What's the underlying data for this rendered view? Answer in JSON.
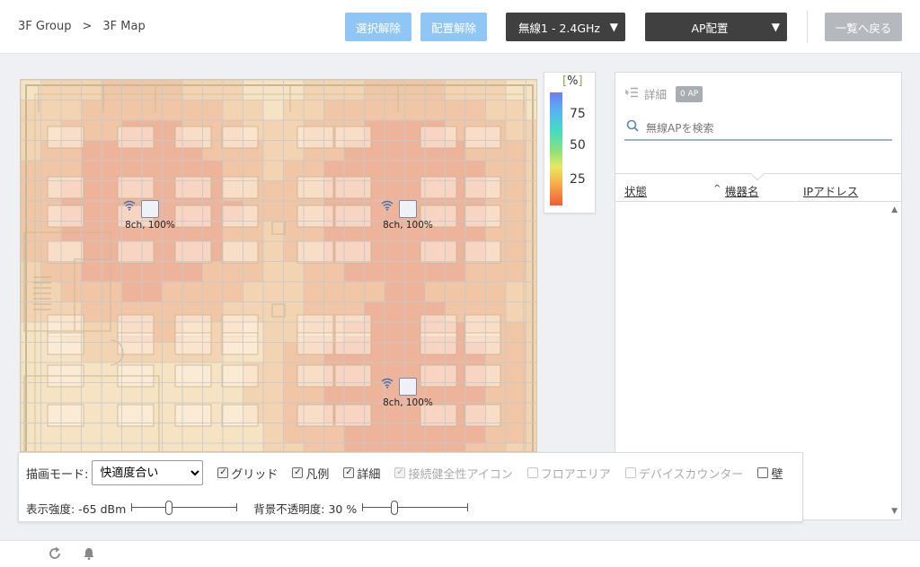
{
  "breadcrumb": {
    "group": "3F Group",
    "separator": ">",
    "map": "3F Map"
  },
  "toolbar": {
    "deselect_label": "選択解除",
    "unplace_label": "配置解除",
    "band_select": "無線1 - 2.4GHz",
    "ap_place_select": "AP配置",
    "back_label": "一覧へ戻る"
  },
  "legend": {
    "unit_open": "[",
    "unit": "%",
    "unit_close": "]",
    "ticks": [
      "75",
      "50",
      "25"
    ]
  },
  "access_points": [
    {
      "label": "8ch, 100%"
    },
    {
      "label": "8ch, 100%"
    },
    {
      "label": "8ch, 100%"
    }
  ],
  "panel": {
    "detail_label": "詳細",
    "ap_count": "0 AP",
    "search_placeholder": "無線APを検索",
    "columns": {
      "status": "状態",
      "sort_indicator": "^",
      "device_name": "機器名",
      "ip_address": "IPアドレス"
    }
  },
  "controls": {
    "draw_mode_label": "描画モード:",
    "draw_mode_value": "快適度合い",
    "checkboxes": [
      {
        "label": "グリッド",
        "checked": true,
        "disabled": false
      },
      {
        "label": "凡例",
        "checked": true,
        "disabled": false
      },
      {
        "label": "詳細",
        "checked": true,
        "disabled": false
      },
      {
        "label": "接続健全性アイコン",
        "checked": true,
        "disabled": true
      },
      {
        "label": "フロアエリア",
        "checked": false,
        "disabled": true
      },
      {
        "label": "デバイスカウンター",
        "checked": false,
        "disabled": true
      },
      {
        "label": "壁",
        "checked": false,
        "disabled": false
      }
    ],
    "strength_label": "表示強度: -65 dBm",
    "strength_level": 0.35,
    "opacity_label": "背景不透明度: 30 %",
    "opacity_level": 0.3
  },
  "colors": {
    "accent_blue": "#8fc6f5",
    "dark_select": "#404040",
    "gray_button": "#b5b8bc",
    "heat_high": "#e8a08c",
    "floor": "#f5e3c3"
  },
  "footer": {
    "icons": [
      "refresh-icon",
      "bell-icon"
    ]
  }
}
